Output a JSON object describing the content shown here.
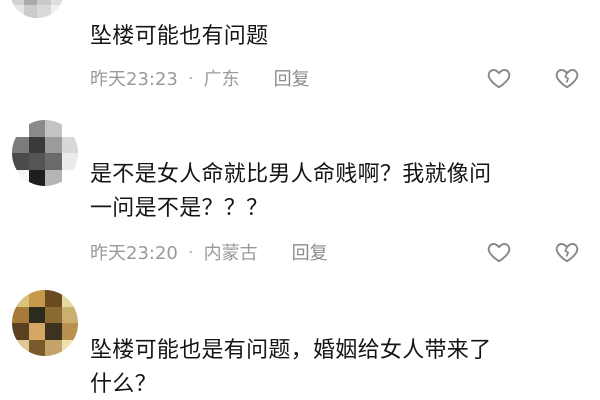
{
  "comments": [
    {
      "text": "坠楼可能也有问题",
      "time": "昨天23:23",
      "location": "广东",
      "reply_label": "回复",
      "like_icon": "heart-outline-icon",
      "dislike_icon": "broken-heart-icon"
    },
    {
      "text_line1": "是不是女人命就比男人命贱啊？我就像问",
      "text_line2": "一问是不是？？？",
      "time": "昨天23:20",
      "location": "内蒙古",
      "reply_label": "回复",
      "like_icon": "heart-outline-icon",
      "dislike_icon": "broken-heart-icon"
    },
    {
      "text_line1": "坠楼可能也是有问题，婚姻给女人带来了",
      "text_line2": "什么？"
    }
  ],
  "separator": "·",
  "colors": {
    "text": "#151515",
    "meta": "#9a9a9a",
    "icon": "#8a8a8a"
  }
}
